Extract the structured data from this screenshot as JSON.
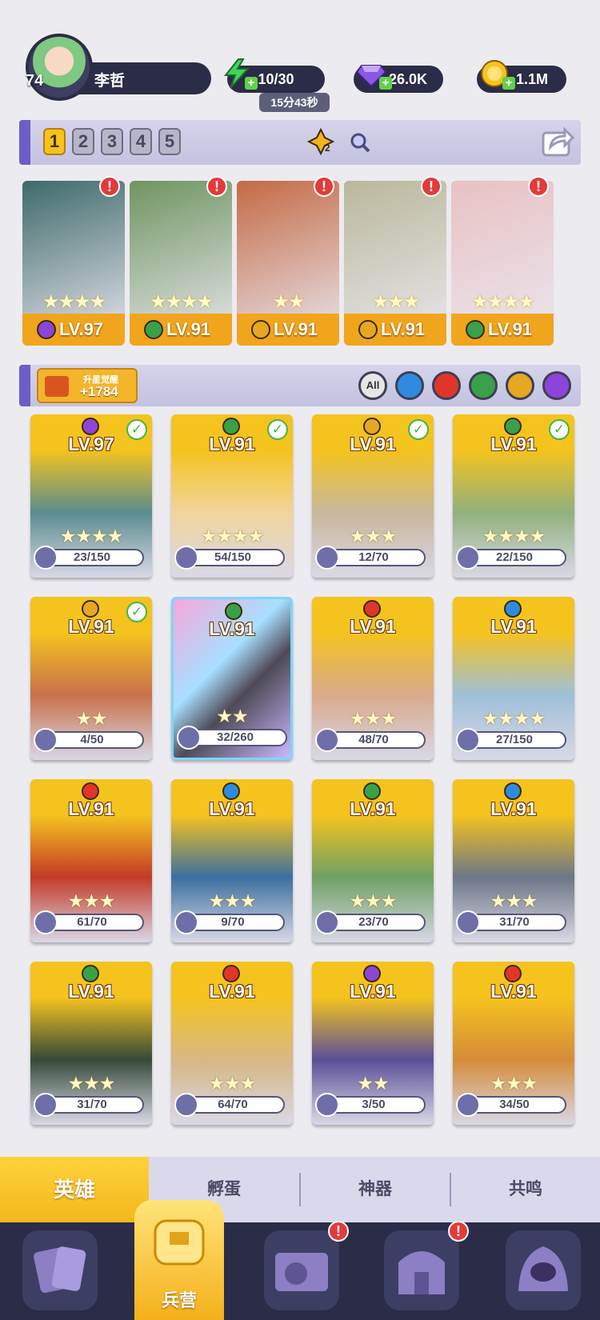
{
  "player": {
    "level": "74",
    "name": "李哲"
  },
  "resources": {
    "energy": "10/30",
    "energy_timer": "15分43秒",
    "gems": "26.0K",
    "gold": "1.1M"
  },
  "team_tabs": [
    "1",
    "2",
    "3",
    "4",
    "5"
  ],
  "team_active": "1",
  "team_extra": {
    "badge": "2"
  },
  "featured": [
    {
      "lv": "LV.97",
      "stars": "★★★★",
      "element": "dark",
      "color": "#8d44d9",
      "art": "#3e6a6a"
    },
    {
      "lv": "LV.91",
      "stars": "★★★★",
      "element": "nature",
      "color": "#39a14a",
      "art": "#6f9560"
    },
    {
      "lv": "LV.91",
      "stars": "★★",
      "element": "light",
      "color": "#e6a821",
      "art": "#c46a45"
    },
    {
      "lv": "LV.91",
      "stars": "★★★",
      "element": "light",
      "color": "#e6a821",
      "art": "#b9b89a"
    },
    {
      "lv": "LV.91",
      "stars": "★★★★",
      "element": "nature",
      "color": "#39a14a",
      "art": "#e9c1c3"
    }
  ],
  "awaken": {
    "label": "升星觉醒",
    "value": "+1784"
  },
  "filters": {
    "all": "All",
    "colors": [
      "#2f8be0",
      "#e0362a",
      "#39a14a",
      "#e6a821",
      "#8d44d9"
    ]
  },
  "heroes": [
    {
      "lv": "LV.97",
      "stars": "★★★★",
      "shards": "23/150",
      "element": "#8d44d9",
      "check": true,
      "art": "#5a8c8e"
    },
    {
      "lv": "LV.91",
      "stars": "★★★★",
      "shards": "54/150",
      "element": "#39a14a",
      "check": true,
      "art": "#f1d59a"
    },
    {
      "lv": "LV.91",
      "stars": "★★★",
      "shards": "12/70",
      "element": "#e6a821",
      "check": true,
      "art": "#c8b79c"
    },
    {
      "lv": "LV.91",
      "stars": "★★★★",
      "shards": "22/150",
      "element": "#39a14a",
      "check": true,
      "art": "#90b07c"
    },
    {
      "lv": "LV.91",
      "stars": "★★",
      "shards": "4/50",
      "element": "#e6a821",
      "check": true,
      "art": "#c9704a"
    },
    {
      "lv": "LV.91",
      "stars": "★★",
      "shards": "32/260",
      "element": "#39a14a",
      "check": false,
      "art": "#4e4a56"
    },
    {
      "lv": "LV.91",
      "stars": "★★★",
      "shards": "48/70",
      "element": "#e0362a",
      "check": false,
      "art": "#d9a98a"
    },
    {
      "lv": "LV.91",
      "stars": "★★★★",
      "shards": "27/150",
      "element": "#2f8be0",
      "check": false,
      "art": "#9fbfd9"
    },
    {
      "lv": "LV.91",
      "stars": "★★★",
      "shards": "61/70",
      "element": "#e0362a",
      "check": false,
      "art": "#c43a28"
    },
    {
      "lv": "LV.91",
      "stars": "★★★",
      "shards": "9/70",
      "element": "#2f8be0",
      "check": false,
      "art": "#3b6fa0"
    },
    {
      "lv": "LV.91",
      "stars": "★★★",
      "shards": "23/70",
      "element": "#39a14a",
      "check": false,
      "art": "#6fa065"
    },
    {
      "lv": "LV.91",
      "stars": "★★★",
      "shards": "31/70",
      "element": "#2f8be0",
      "check": false,
      "art": "#6c7687"
    },
    {
      "lv": "LV.91",
      "stars": "★★★",
      "shards": "31/70",
      "element": "#39a14a",
      "check": false,
      "art": "#354a3a"
    },
    {
      "lv": "LV.91",
      "stars": "★★★",
      "shards": "64/70",
      "element": "#e0362a",
      "check": false,
      "art": "#d7b783"
    },
    {
      "lv": "LV.91",
      "stars": "★★",
      "shards": "3/50",
      "element": "#8d44d9",
      "check": false,
      "art": "#5a4f99"
    },
    {
      "lv": "LV.91",
      "stars": "★★★",
      "shards": "34/50",
      "element": "#e0362a",
      "check": false,
      "art": "#d58c3a"
    }
  ],
  "subtabs": [
    "英雄",
    "孵蛋",
    "神器",
    "共鸣"
  ],
  "subtab_active": "英雄",
  "nav": {
    "active_label": "兵营",
    "alert": "!"
  }
}
